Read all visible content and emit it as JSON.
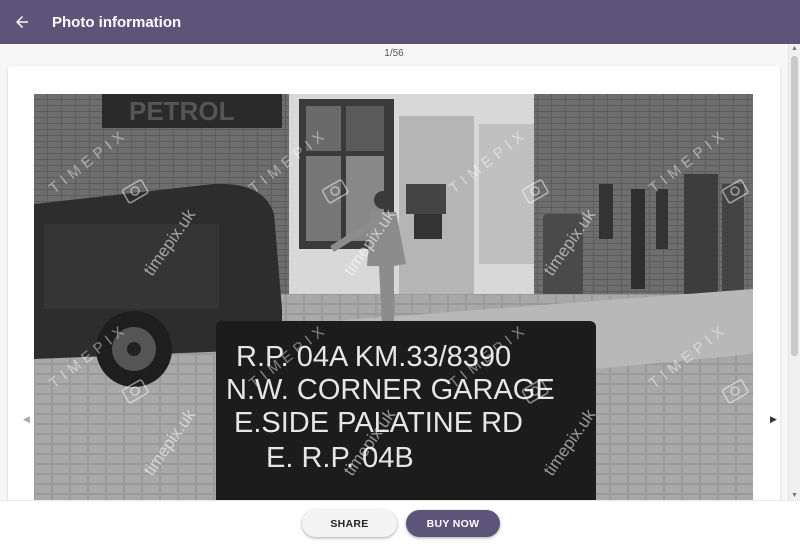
{
  "header": {
    "title": "Photo information",
    "back_icon": "arrow-left-icon"
  },
  "pager": {
    "counter": "1/56"
  },
  "photo": {
    "watermark": "timepix.uk",
    "watermark_brand": "TIMEPIX",
    "signage": {
      "shop_sign": "PETROL",
      "board_line1": "R.P. 04A   KM.33/8390",
      "board_line2": "N.W. CORNER GARAGE",
      "board_line3": "E.SIDE PALATINE RD",
      "board_line4": "E. R.P. 04B"
    }
  },
  "actions": {
    "share_label": "SHARE",
    "buy_label": "BUY NOW"
  },
  "colors": {
    "accent": "#5d5479"
  }
}
